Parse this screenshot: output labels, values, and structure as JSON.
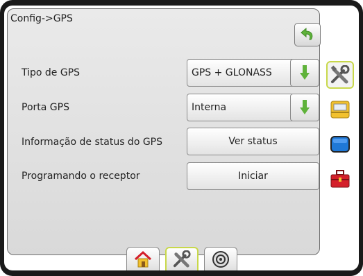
{
  "header": {
    "title": "Config->GPS"
  },
  "rows": [
    {
      "label": "Tipo de GPS",
      "value": "GPS + GLONASS"
    },
    {
      "label": "Porta GPS",
      "value": "Interna"
    },
    {
      "label": "Informação de status do GPS",
      "button": "Ver status"
    },
    {
      "label": "Programando o receptor",
      "button": "Iniciar"
    }
  ],
  "icons": {
    "back": "back-arrow-icon",
    "dropdown": "green-down-arrow-icon",
    "side_tabs": [
      "tools-icon",
      "console-icon",
      "display-icon",
      "toolbox-icon"
    ],
    "bottom_tabs": [
      "home-icon",
      "tools-icon",
      "guidance-icon"
    ]
  },
  "colors": {
    "accent_green": "#5fb23a",
    "active_outline": "#c8d84a",
    "toolbox_red": "#d41f2a",
    "display_blue": "#1f78d6"
  }
}
